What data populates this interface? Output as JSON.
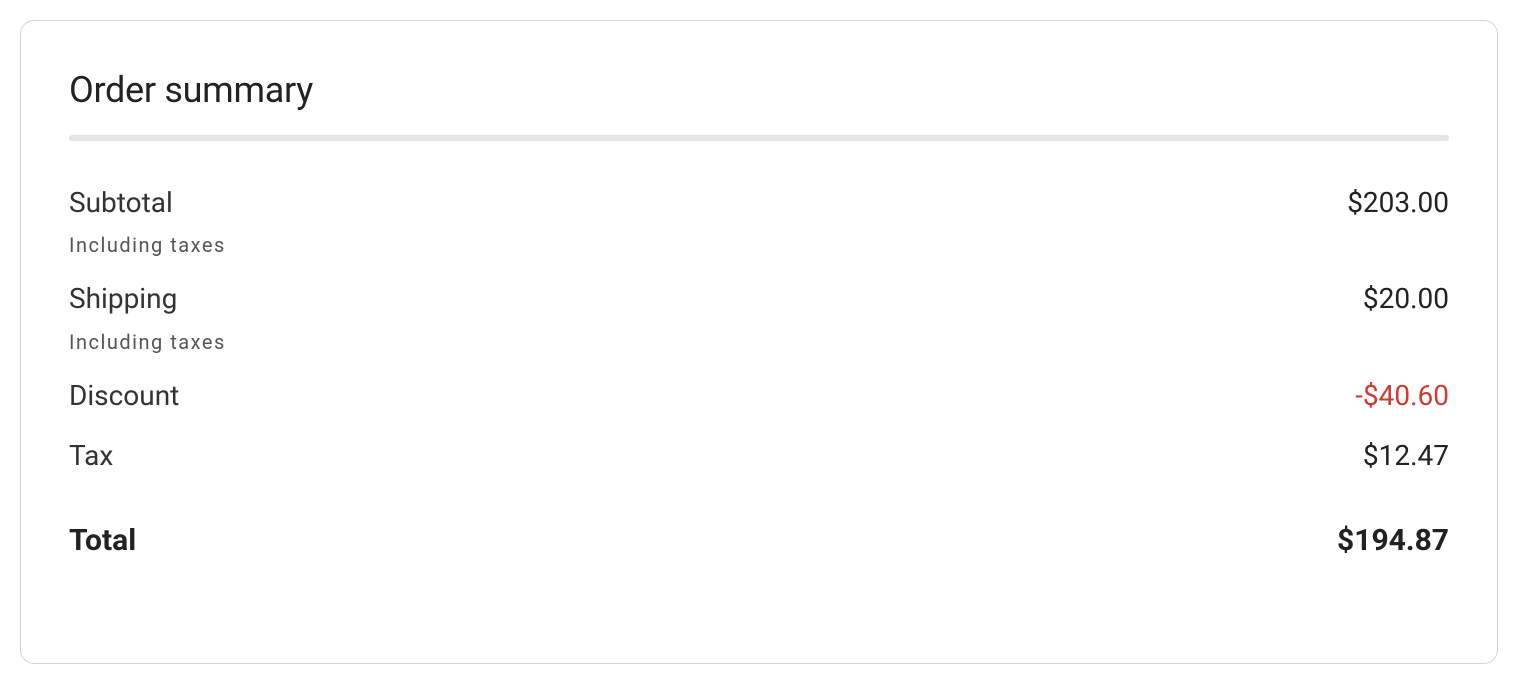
{
  "summary": {
    "title": "Order summary",
    "subtotal": {
      "label": "Subtotal",
      "note": "Including taxes",
      "value": "$203.00"
    },
    "shipping": {
      "label": "Shipping",
      "note": "Including taxes",
      "value": "$20.00"
    },
    "discount": {
      "label": "Discount",
      "value": "-$40.60"
    },
    "tax": {
      "label": "Tax",
      "value": "$12.47"
    },
    "total": {
      "label": "Total",
      "value": "$194.87"
    }
  }
}
